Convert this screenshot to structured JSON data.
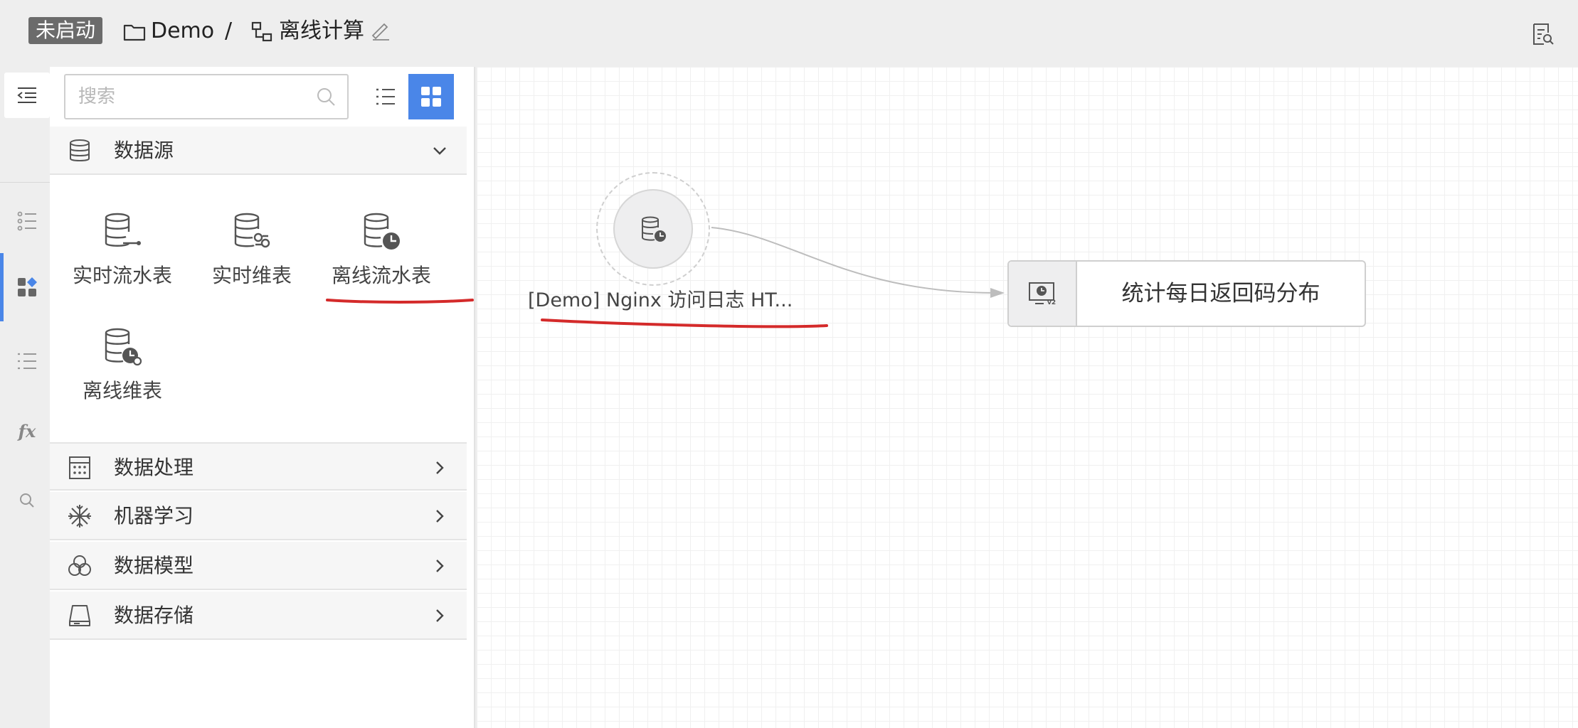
{
  "header": {
    "status": "未启动",
    "project": "Demo",
    "separator": "/",
    "task_name": "离线计算"
  },
  "sidebar": {
    "search_placeholder": "搜索",
    "sections": [
      {
        "label": "数据源",
        "icon": "database-icon",
        "expanded": true
      },
      {
        "label": "数据处理",
        "icon": "calculator-icon",
        "expanded": false
      },
      {
        "label": "机器学习",
        "icon": "snowflake-icon",
        "expanded": false
      },
      {
        "label": "数据模型",
        "icon": "model-icon",
        "expanded": false
      },
      {
        "label": "数据存储",
        "icon": "storage-icon",
        "expanded": false
      }
    ],
    "datasource_items": [
      {
        "label": "实时流水表",
        "icon": "realtime-stream-table-icon"
      },
      {
        "label": "实时维表",
        "icon": "realtime-dim-table-icon"
      },
      {
        "label": "离线流水表",
        "icon": "offline-stream-table-icon"
      },
      {
        "label": "离线维表",
        "icon": "offline-dim-table-icon"
      }
    ]
  },
  "canvas": {
    "source_node_label": "[Demo] Nginx 访问日志 HT...",
    "task_node_label": "统计每日返回码分布"
  },
  "colors": {
    "accent": "#4a86e8",
    "annotation": "#d42a2a",
    "status_badge": "#6b6b6b"
  }
}
